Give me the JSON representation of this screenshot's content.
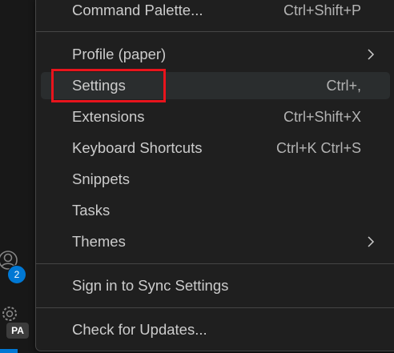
{
  "activity_bar": {
    "accounts_badge_count": "2",
    "profile_badge": "PA",
    "icons": [
      "accounts-icon",
      "manage-gear-icon"
    ]
  },
  "menu": {
    "items": [
      {
        "label": "Command Palette...",
        "shortcut": "Ctrl+Shift+P"
      },
      {
        "label": "Profile (paper)",
        "submenu": true
      },
      {
        "label": "Settings",
        "shortcut": "Ctrl+,",
        "hovered": true,
        "highlighted": true
      },
      {
        "label": "Extensions",
        "shortcut": "Ctrl+Shift+X"
      },
      {
        "label": "Keyboard Shortcuts",
        "shortcut": "Ctrl+K Ctrl+S"
      },
      {
        "label": "Snippets"
      },
      {
        "label": "Tasks"
      },
      {
        "label": "Themes",
        "submenu": true
      },
      {
        "label": "Sign in to Sync Settings"
      },
      {
        "label": "Check for Updates..."
      }
    ]
  },
  "colors": {
    "background": "#181818",
    "menu_background": "#1f1f1f",
    "hover_background": "#2a2d2e",
    "badge_blue": "#0078d4",
    "highlight_red": "#e8141c"
  }
}
